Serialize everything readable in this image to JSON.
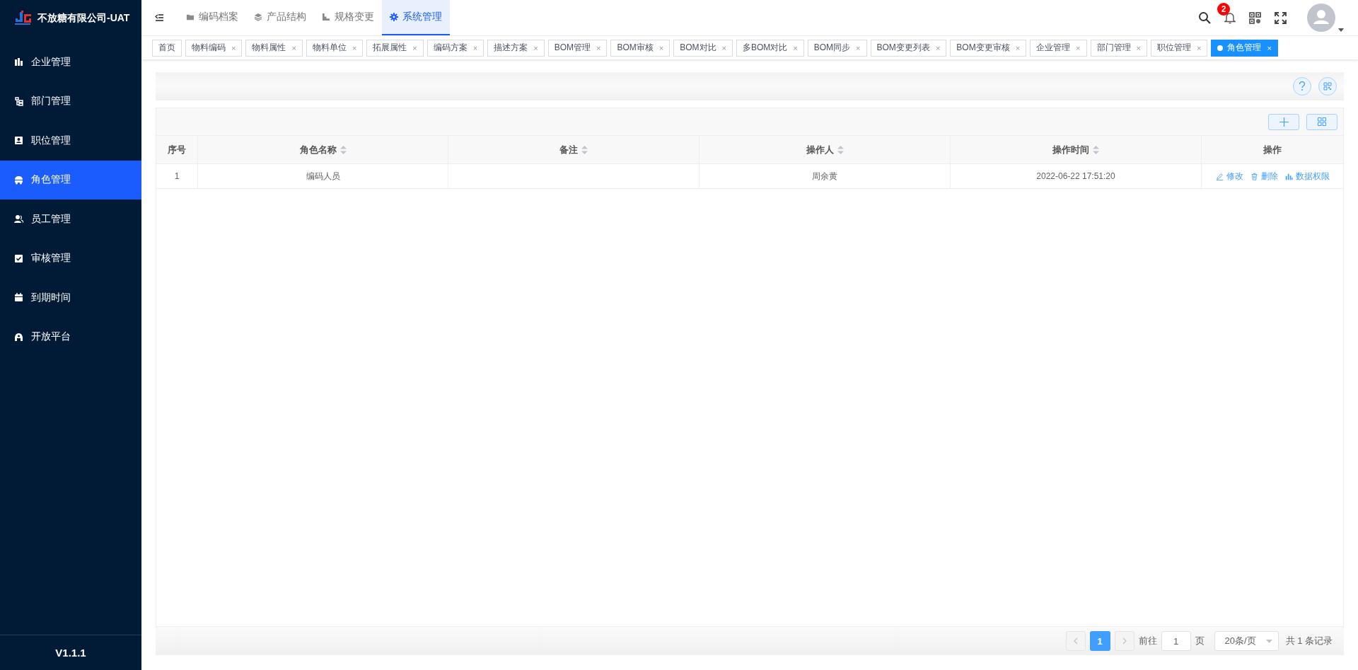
{
  "app": {
    "title": "不放糖有限公司-UAT",
    "version": "V1.1.1"
  },
  "sidebar": {
    "items": [
      {
        "label": "企业管理",
        "selected": false
      },
      {
        "label": "部门管理",
        "selected": false
      },
      {
        "label": "职位管理",
        "selected": false
      },
      {
        "label": "角色管理",
        "selected": true
      },
      {
        "label": "员工管理",
        "selected": false
      },
      {
        "label": "审核管理",
        "selected": false
      },
      {
        "label": "到期时间",
        "selected": false
      },
      {
        "label": "开放平台",
        "selected": false
      }
    ]
  },
  "top_nav": {
    "modules": [
      {
        "label": "编码档案",
        "selected": false
      },
      {
        "label": "产品结构",
        "selected": false
      },
      {
        "label": "规格变更",
        "selected": false
      },
      {
        "label": "系统管理",
        "selected": true
      }
    ],
    "notification_count": "2"
  },
  "tags": [
    {
      "label": "首页",
      "selected": false
    },
    {
      "label": "物料编码",
      "selected": false,
      "close_mark": "×"
    },
    {
      "label": "物料属性",
      "selected": false,
      "close_mark": "×"
    },
    {
      "label": "物料单位",
      "selected": false,
      "close_mark": "×"
    },
    {
      "label": "拓展属性",
      "selected": false,
      "close_mark": "×"
    },
    {
      "label": "编码方案",
      "selected": false,
      "close_mark": "×"
    },
    {
      "label": "描述方案",
      "selected": false,
      "close_mark": "×"
    },
    {
      "label": "BOM管理",
      "selected": false,
      "close_mark": "×"
    },
    {
      "label": "BOM审核",
      "selected": false,
      "close_mark": "×"
    },
    {
      "label": "BOM对比",
      "selected": false,
      "close_mark": "×"
    },
    {
      "label": "多BOM对比",
      "selected": false,
      "close_mark": "×"
    },
    {
      "label": "BOM同步",
      "selected": false,
      "close_mark": "×"
    },
    {
      "label": "BOM变更列表",
      "selected": false,
      "close_mark": "×"
    },
    {
      "label": "BOM变更审核",
      "selected": false,
      "close_mark": "×"
    },
    {
      "label": "企业管理",
      "selected": false,
      "close_mark": "×"
    },
    {
      "label": "部门管理",
      "selected": false,
      "close_mark": "×"
    },
    {
      "label": "职位管理",
      "selected": false,
      "close_mark": "×"
    },
    {
      "label": "角色管理",
      "selected": true,
      "close_mark": "×"
    }
  ],
  "table": {
    "columns": [
      {
        "label": "序号",
        "sortable": false
      },
      {
        "label": "角色名称",
        "sortable": true
      },
      {
        "label": "备注",
        "sortable": true
      },
      {
        "label": "操作人",
        "sortable": true
      },
      {
        "label": "操作时间",
        "sortable": true
      },
      {
        "label": "操作",
        "sortable": false
      }
    ],
    "rows": [
      {
        "cells": [
          "1",
          "编码人员",
          "",
          "周余黄",
          "2022-06-22 17:51:20"
        ],
        "actions": [
          {
            "kind": "edit",
            "label": "修改"
          },
          {
            "kind": "delete",
            "label": "删除"
          },
          {
            "kind": "permissions",
            "label": "数据权限"
          }
        ]
      }
    ]
  },
  "pagination": {
    "pages": [
      {
        "label": "1",
        "selected": true
      }
    ],
    "goto_label": "前往",
    "goto_value": "1",
    "page_unit": "页",
    "page_size": "20条/页",
    "total": "共 1 条记录"
  }
}
